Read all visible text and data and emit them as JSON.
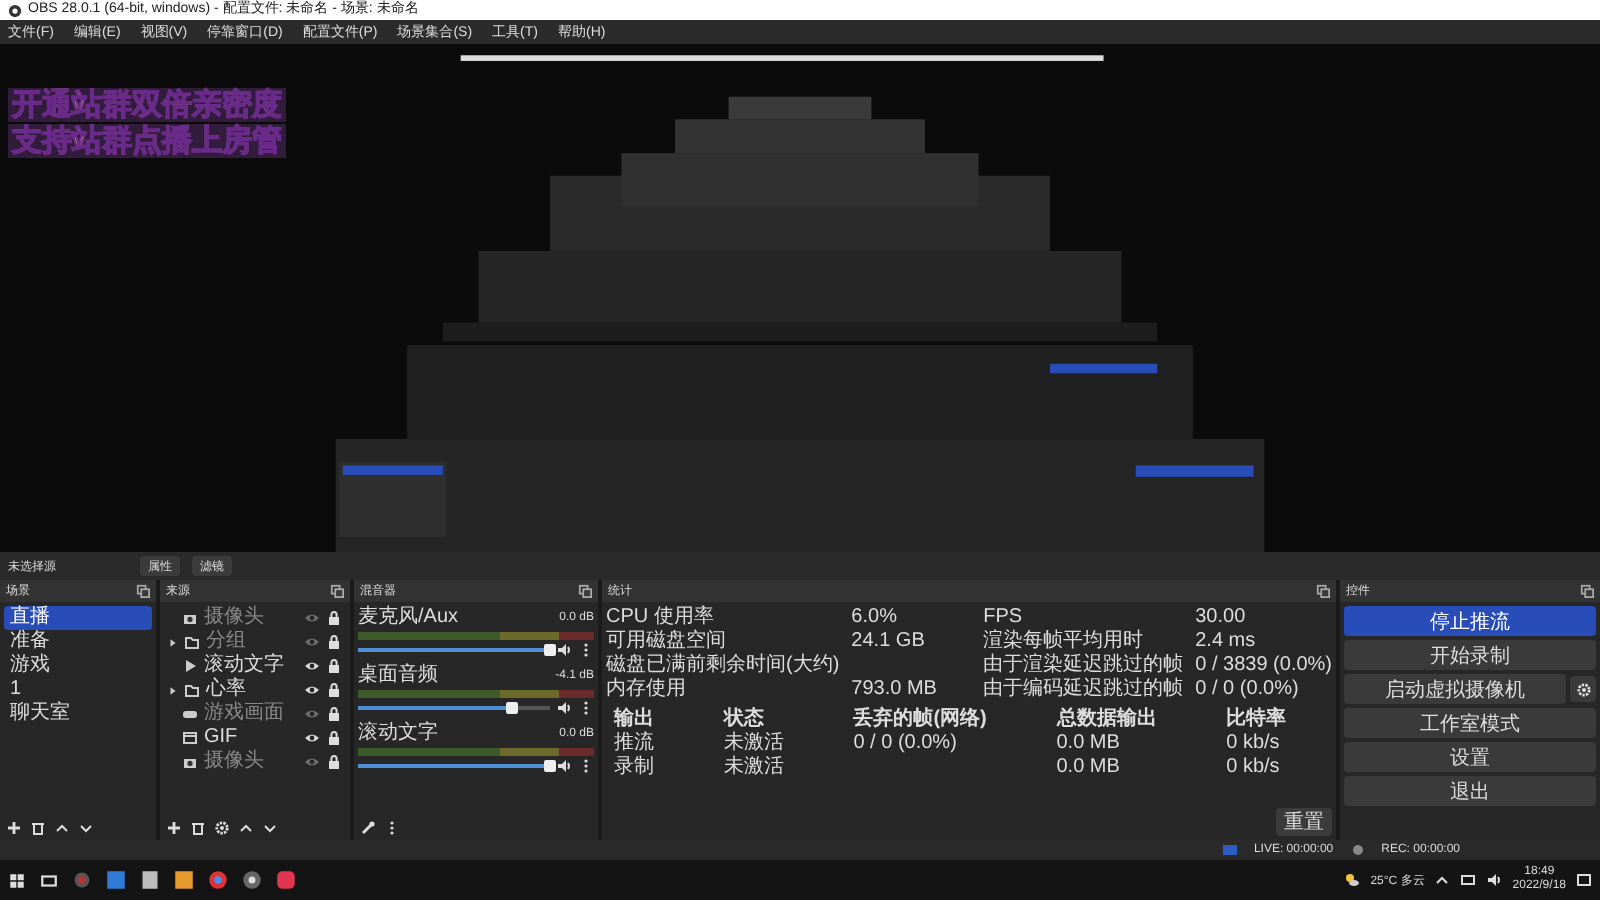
{
  "window": {
    "title": "OBS 28.0.1 (64-bit, windows) - 配置文件: 未命名 - 场景: 未命名"
  },
  "menu": [
    "文件(F)",
    "编辑(E)",
    "视图(V)",
    "停靠窗口(D)",
    "配置文件(P)",
    "场景集合(S)",
    "工具(T)",
    "帮助(H)"
  ],
  "preview": {
    "banner_lines": [
      "开通站群双倍亲密度",
      "支持站群点播上房管"
    ]
  },
  "source_bar": {
    "label": "未选择源",
    "buttons": [
      "属性",
      "滤镜"
    ]
  },
  "scenes": {
    "title": "场景",
    "items": [
      {
        "name": "直播",
        "selected": true
      },
      {
        "name": "准备",
        "selected": false
      },
      {
        "name": "游戏",
        "selected": false
      },
      {
        "name": "1",
        "selected": false
      },
      {
        "name": "聊天室",
        "selected": false
      }
    ]
  },
  "sources": {
    "title": "来源",
    "items": [
      {
        "name": "摄像头",
        "kind": "camera",
        "group": false,
        "visible": false
      },
      {
        "name": "分组",
        "kind": "folder",
        "group": true,
        "visible": false
      },
      {
        "name": "滚动文字",
        "kind": "media",
        "group": false,
        "visible": true
      },
      {
        "name": "心率",
        "kind": "folder",
        "group": true,
        "visible": true
      },
      {
        "name": "游戏画面",
        "kind": "game",
        "group": false,
        "visible": false
      },
      {
        "name": "GIF",
        "kind": "window",
        "group": false,
        "visible": true
      },
      {
        "name": "摄像头",
        "kind": "camera",
        "group": false,
        "visible": false
      }
    ]
  },
  "mixer": {
    "title": "混音器",
    "channels": [
      {
        "name": "麦克风/Aux",
        "reading": "0.0 dB",
        "level": 1.0
      },
      {
        "name": "桌面音频",
        "reading": "-4.1 dB",
        "level": 0.8
      },
      {
        "name": "滚动文字",
        "reading": "0.0 dB",
        "level": 1.0
      }
    ]
  },
  "stats": {
    "title": "统计",
    "left": [
      {
        "label": "CPU 使用率",
        "value": "6.0%"
      },
      {
        "label": "可用磁盘空间",
        "value": "24.1 GB"
      },
      {
        "label": "磁盘已满前剩余时间(大约)"
      },
      {
        "label": "内存使用",
        "value": "793.0 MB"
      }
    ],
    "right": [
      {
        "label": "FPS",
        "value": "30.00"
      },
      {
        "label": "渲染每帧平均用时",
        "value": "2.4 ms"
      },
      {
        "label": "由于渲染延迟跳过的帧",
        "value": "0 / 3839 (0.0%)"
      },
      {
        "label": "由于编码延迟跳过的帧",
        "value": "0 / 0 (0.0%)"
      }
    ],
    "columns": [
      "输出",
      "状态",
      "丢弃的帧(网络)",
      "总数据输出",
      "比特率"
    ],
    "rows": [
      [
        "推流",
        "未激活",
        "0 / 0 (0.0%)",
        "0.0 MB",
        "0 kb/s"
      ],
      [
        "录制",
        "未激活",
        "",
        "0.0 MB",
        "0 kb/s"
      ]
    ],
    "reset_button": "重置"
  },
  "controls": {
    "title": "控件",
    "buttons": [
      {
        "label": "停止推流",
        "active": true,
        "has_settings": false
      },
      {
        "label": "开始录制",
        "active": false,
        "has_settings": false
      },
      {
        "label": "启动虚拟摄像机",
        "active": false,
        "has_settings": true
      },
      {
        "label": "工作室模式",
        "active": false,
        "has_settings": false
      },
      {
        "label": "设置",
        "active": false,
        "has_settings": false
      },
      {
        "label": "退出",
        "active": false,
        "has_settings": false
      }
    ]
  },
  "status_bar": {
    "live": "LIVE: 00:00:00",
    "rec": "REC: 00:00:00"
  },
  "taskbar": {
    "weather": "25°C 多云",
    "time": "18:49",
    "date": "2022/9/18"
  }
}
